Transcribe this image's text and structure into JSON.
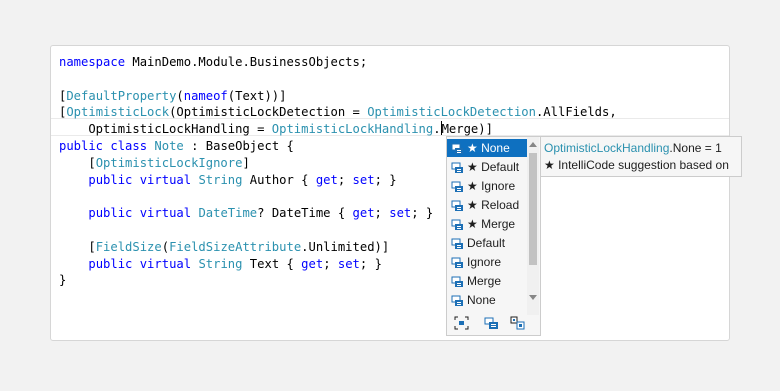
{
  "code": {
    "line1": {
      "kw": "namespace",
      "rest": " MainDemo.Module.BusinessObjects;"
    },
    "line3": {
      "open": "[",
      "attr": "DefaultProperty",
      "p1": "(",
      "kw": "nameof",
      "rest": "(Text))]"
    },
    "line4": {
      "open": "[",
      "attr": "OptimisticLock",
      "p1": "(OptimisticLockDetection = ",
      "type": "OptimisticLockDetection",
      "rest": ".AllFields,"
    },
    "line5": {
      "indent": "    OptimisticLockHandling = ",
      "type": "OptimisticLockHandling",
      "dot": ".",
      "rest": "Merge)]"
    },
    "line6": {
      "kw": "public class",
      "sp": " ",
      "type": "Note",
      "rest": " : BaseObject {"
    },
    "line7": {
      "indent": "    [",
      "attr": "OptimisticLockIgnore",
      "rest": "]"
    },
    "line8": {
      "indent": "    ",
      "kw": "public virtual",
      "sp": " ",
      "type": "String",
      "mid": " Author { ",
      "get": "get",
      "semi": "; ",
      "set": "set",
      "end": "; }"
    },
    "line10": {
      "indent": "    ",
      "kw": "public virtual",
      "sp": " ",
      "type": "DateTime",
      "mid": "? DateTime { ",
      "get": "get",
      "semi": "; ",
      "set": "set",
      "end": "; }"
    },
    "line12": {
      "indent": "    [",
      "attr": "FieldSize",
      "p1": "(",
      "type": "FieldSizeAttribute",
      "rest": ".Unlimited)]"
    },
    "line13": {
      "indent": "    ",
      "kw": "public virtual",
      "sp": " ",
      "type": "String",
      "mid": " Text { ",
      "get": "get",
      "semi": "; ",
      "set": "set",
      "end": "; }"
    },
    "line14": {
      "text": "}"
    }
  },
  "completion": {
    "items": [
      {
        "label": "★ None",
        "selected": true
      },
      {
        "label": "★ Default"
      },
      {
        "label": "★ Ignore"
      },
      {
        "label": "★ Reload"
      },
      {
        "label": "★ Merge"
      },
      {
        "label": "Default"
      },
      {
        "label": "Ignore"
      },
      {
        "label": "Merge"
      },
      {
        "label": "None"
      }
    ],
    "icon": "enum-member-icon",
    "filters": [
      "expand-collapse-icon",
      "enum-member-filter-icon",
      "show-completion-icon"
    ]
  },
  "tooltip": {
    "type": "OptimisticLockHandling",
    "rest": ".None = 1",
    "line2": "★  IntelliCode suggestion based on"
  },
  "colors": {
    "keyword": "#0000ff",
    "type": "#2b91af",
    "selection": "#0e70c0",
    "icon": "#1c6fb5"
  }
}
